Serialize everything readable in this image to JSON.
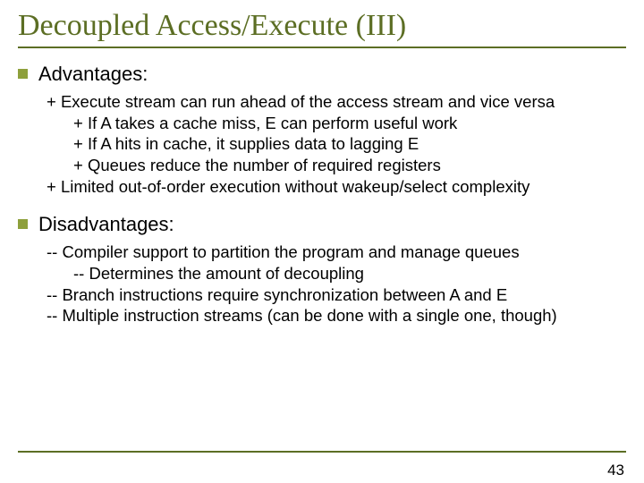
{
  "title": "Decoupled Access/Execute (III)",
  "advantages": {
    "label": "Advantages:",
    "lines": {
      "l1": "+ Execute stream can run ahead of the access stream and vice versa",
      "l2": "+ If A takes a cache miss, E can perform useful work",
      "l3": "+ If A hits in cache, it supplies data to lagging E",
      "l4": "+ Queues reduce the number of required registers",
      "l5": "+ Limited out-of-order execution without wakeup/select complexity"
    }
  },
  "disadvantages": {
    "label": "Disadvantages:",
    "lines": {
      "l1": "-- Compiler support to partition the program and manage queues",
      "l2": "-- Determines the amount of decoupling",
      "l3": "-- Branch instructions require synchronization between A and E",
      "l4": "-- Multiple instruction streams (can be done with a single one, though)"
    }
  },
  "page": "43"
}
